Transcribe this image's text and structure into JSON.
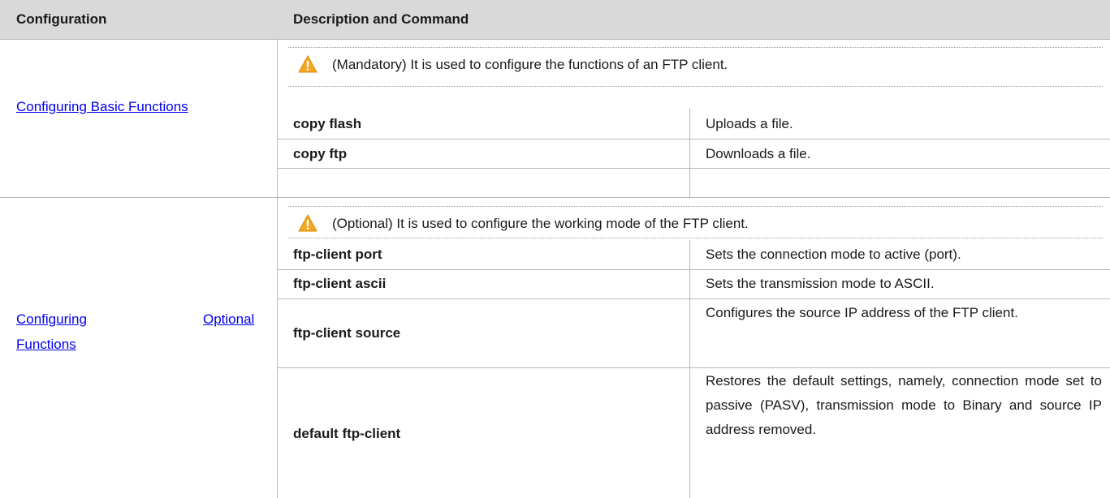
{
  "table": {
    "headers": {
      "configuration": "Configuration",
      "description_and_command": "Description and Command"
    },
    "sections": [
      {
        "link": "Configuring Basic Functions",
        "note": "(Mandatory) It is used to configure the functions of an FTP client.",
        "rows": [
          {
            "command": "copy flash",
            "description": "Uploads a file."
          },
          {
            "command": "copy ftp",
            "description": "Downloads a file."
          }
        ]
      },
      {
        "link_line1_left": "Configuring",
        "link_line1_right": "Optional",
        "link_line2": "Functions",
        "note": "(Optional) It is used to configure the working mode of the FTP client.",
        "rows": [
          {
            "command": "ftp-client port",
            "description": "Sets the connection mode to active (port)."
          },
          {
            "command": "ftp-client ascii",
            "description": "Sets the transmission mode to ASCII."
          },
          {
            "command": "ftp-client source",
            "description": "Configures the source IP address of the FTP client."
          },
          {
            "command": "default ftp-client",
            "description": "Restores the default settings, namely, connection mode set to passive (PASV), transmission mode to Binary and source IP address removed."
          }
        ]
      }
    ]
  }
}
